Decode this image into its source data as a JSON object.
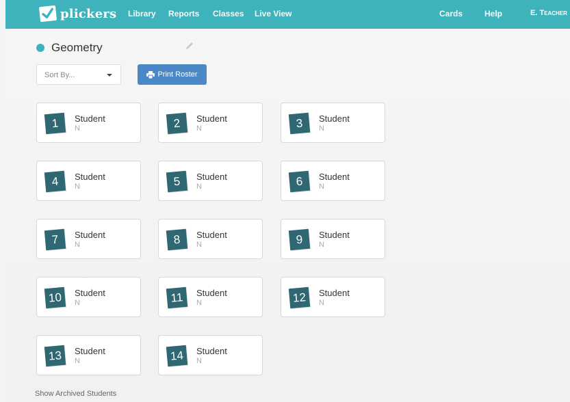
{
  "app": {
    "logo_text": "plickers",
    "nav": {
      "library": "Library",
      "reports": "Reports",
      "classes": "Classes",
      "live_view": "Live View",
      "cards": "Cards",
      "help": "Help",
      "user": "E. Teacher"
    },
    "accent_color": "#3eb3bc"
  },
  "class": {
    "title": "Geometry",
    "dot_color": "#3eb3bc"
  },
  "toolbar": {
    "sort_label": "Sort By...",
    "print_label": "Print Roster"
  },
  "students": [
    {
      "number": "1",
      "first": "Student",
      "last": "N"
    },
    {
      "number": "2",
      "first": "Student",
      "last": "N"
    },
    {
      "number": "3",
      "first": "Student",
      "last": "N"
    },
    {
      "number": "4",
      "first": "Student",
      "last": "N"
    },
    {
      "number": "5",
      "first": "Student",
      "last": "N"
    },
    {
      "number": "6",
      "first": "Student",
      "last": "N"
    },
    {
      "number": "7",
      "first": "Student",
      "last": "N"
    },
    {
      "number": "8",
      "first": "Student",
      "last": "N"
    },
    {
      "number": "9",
      "first": "Student",
      "last": "N"
    },
    {
      "number": "10",
      "first": "Student",
      "last": "N"
    },
    {
      "number": "11",
      "first": "Student",
      "last": "N"
    },
    {
      "number": "12",
      "first": "Student",
      "last": "N"
    },
    {
      "number": "13",
      "first": "Student",
      "last": "N"
    },
    {
      "number": "14",
      "first": "Student",
      "last": "N"
    }
  ],
  "footer": {
    "archived_link": "Show Archived Students"
  }
}
